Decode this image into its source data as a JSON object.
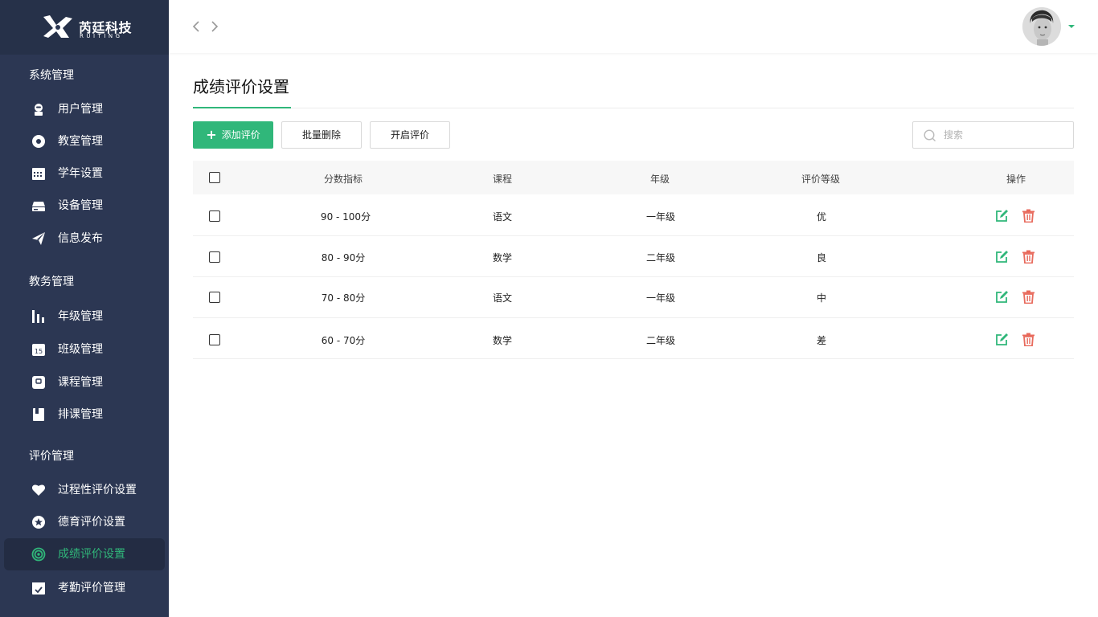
{
  "brand": {
    "name": "芮廷科技",
    "sub": "RUITING",
    "green": "#30b77a",
    "sidebar_bg": "#2c3753",
    "delete_red": "#e86a5c"
  },
  "sidebar": {
    "groups": [
      {
        "title": "系统管理",
        "items": [
          {
            "label": "用户管理",
            "icon": "user-icon"
          },
          {
            "label": "教室管理",
            "icon": "location-pin-icon"
          },
          {
            "label": "学年设置",
            "icon": "calendar-icon"
          },
          {
            "label": "设备管理",
            "icon": "device-icon"
          },
          {
            "label": "信息发布",
            "icon": "paper-plane-icon"
          }
        ]
      },
      {
        "title": "教务管理",
        "items": [
          {
            "label": "年级管理",
            "icon": "bar-chart-icon"
          },
          {
            "label": "班级管理",
            "icon": "calendar-15-icon"
          },
          {
            "label": "课程管理",
            "icon": "course-icon"
          },
          {
            "label": "排课管理",
            "icon": "book-icon"
          }
        ]
      },
      {
        "title": "评价管理",
        "items": [
          {
            "label": "过程性评价设置",
            "icon": "heart-icon"
          },
          {
            "label": "德育评价设置",
            "icon": "star-badge-icon"
          },
          {
            "label": "成绩评价设置",
            "icon": "target-icon",
            "active": true
          },
          {
            "label": "考勤评价管理",
            "icon": "calendar-check-icon"
          }
        ]
      }
    ]
  },
  "page": {
    "title": "成绩评价设置"
  },
  "toolbar": {
    "add_label": "添加评价",
    "batch_delete_label": "批量删除",
    "enable_label": "开启评价",
    "search_placeholder": "搜索"
  },
  "table": {
    "columns": [
      "分数指标",
      "课程",
      "年级",
      "评价等级",
      "操作"
    ],
    "rows": [
      {
        "score": "90 - 100分",
        "course": "语文",
        "grade": "一年级",
        "level": "优"
      },
      {
        "score": "80 - 90分",
        "course": "数学",
        "grade": "二年级",
        "level": "良"
      },
      {
        "score": "70 - 80分",
        "course": "语文",
        "grade": "一年级",
        "level": "中"
      },
      {
        "score": "60 - 70分",
        "course": "数学",
        "grade": "二年级",
        "level": "差"
      }
    ]
  }
}
